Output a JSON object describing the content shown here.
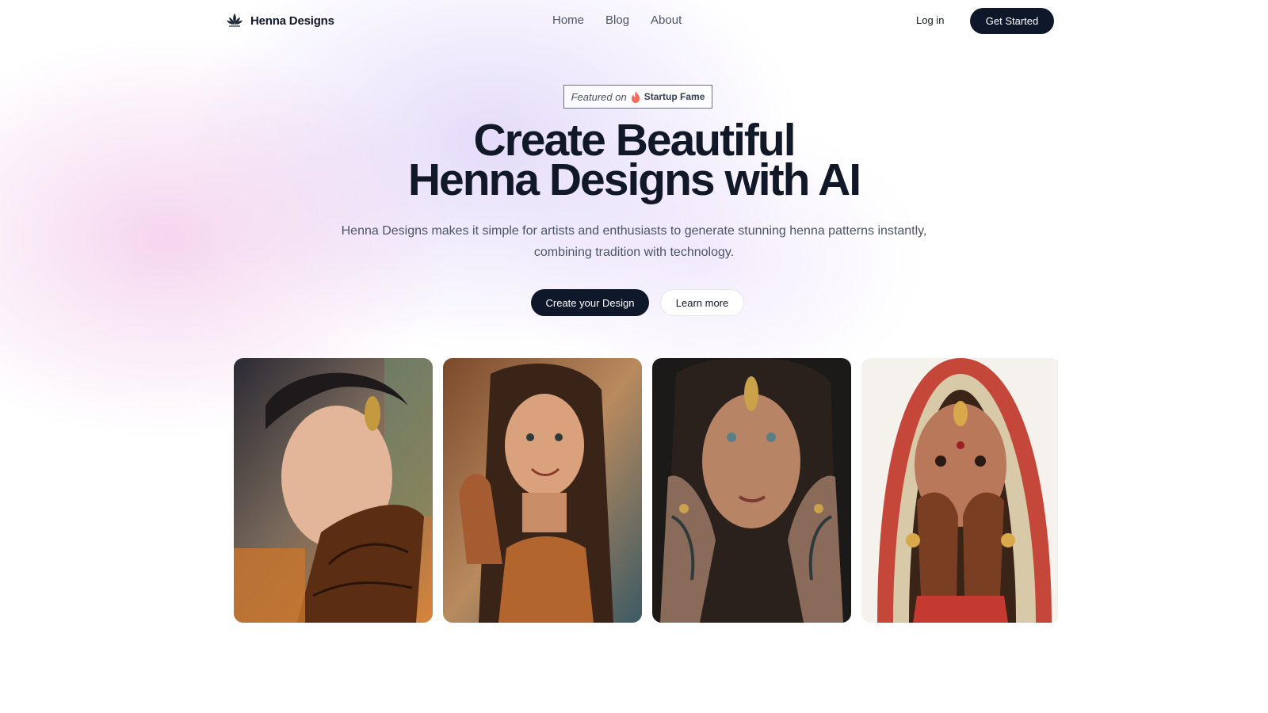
{
  "brand": {
    "name": "Henna Designs",
    "logo_icon": "lotus-icon"
  },
  "nav": {
    "items": [
      {
        "label": "Home"
      },
      {
        "label": "Blog"
      },
      {
        "label": "About"
      }
    ]
  },
  "header": {
    "login_label": "Log in",
    "cta_label": "Get Started"
  },
  "badge": {
    "featured_label": "Featured on",
    "brand_name": "Startup Fame",
    "icon": "flame-icon"
  },
  "hero": {
    "title_line1": "Create Beautiful",
    "title_line2": "Henna Designs with AI",
    "subtitle_line1": "Henna Designs makes it simple for artists and enthusiasts to generate stunning henna patterns instantly,",
    "subtitle_line2": "combining tradition with technology.",
    "primary_cta": "Create your Design",
    "secondary_cta": "Learn more"
  },
  "gallery": {
    "images": [
      {
        "subject": "woman looking down at henna-decorated hand"
      },
      {
        "subject": "smiling woman raising hand with henna"
      },
      {
        "subject": "woman with jewelry and dark henna hands near face"
      },
      {
        "subject": "bride covering face with henna hands"
      }
    ]
  },
  "colors": {
    "primary": "#0f172a",
    "text": "#111827",
    "muted": "#4b5563",
    "glow_pink": "#ecb4e1",
    "glow_purple": "#cebef5"
  }
}
